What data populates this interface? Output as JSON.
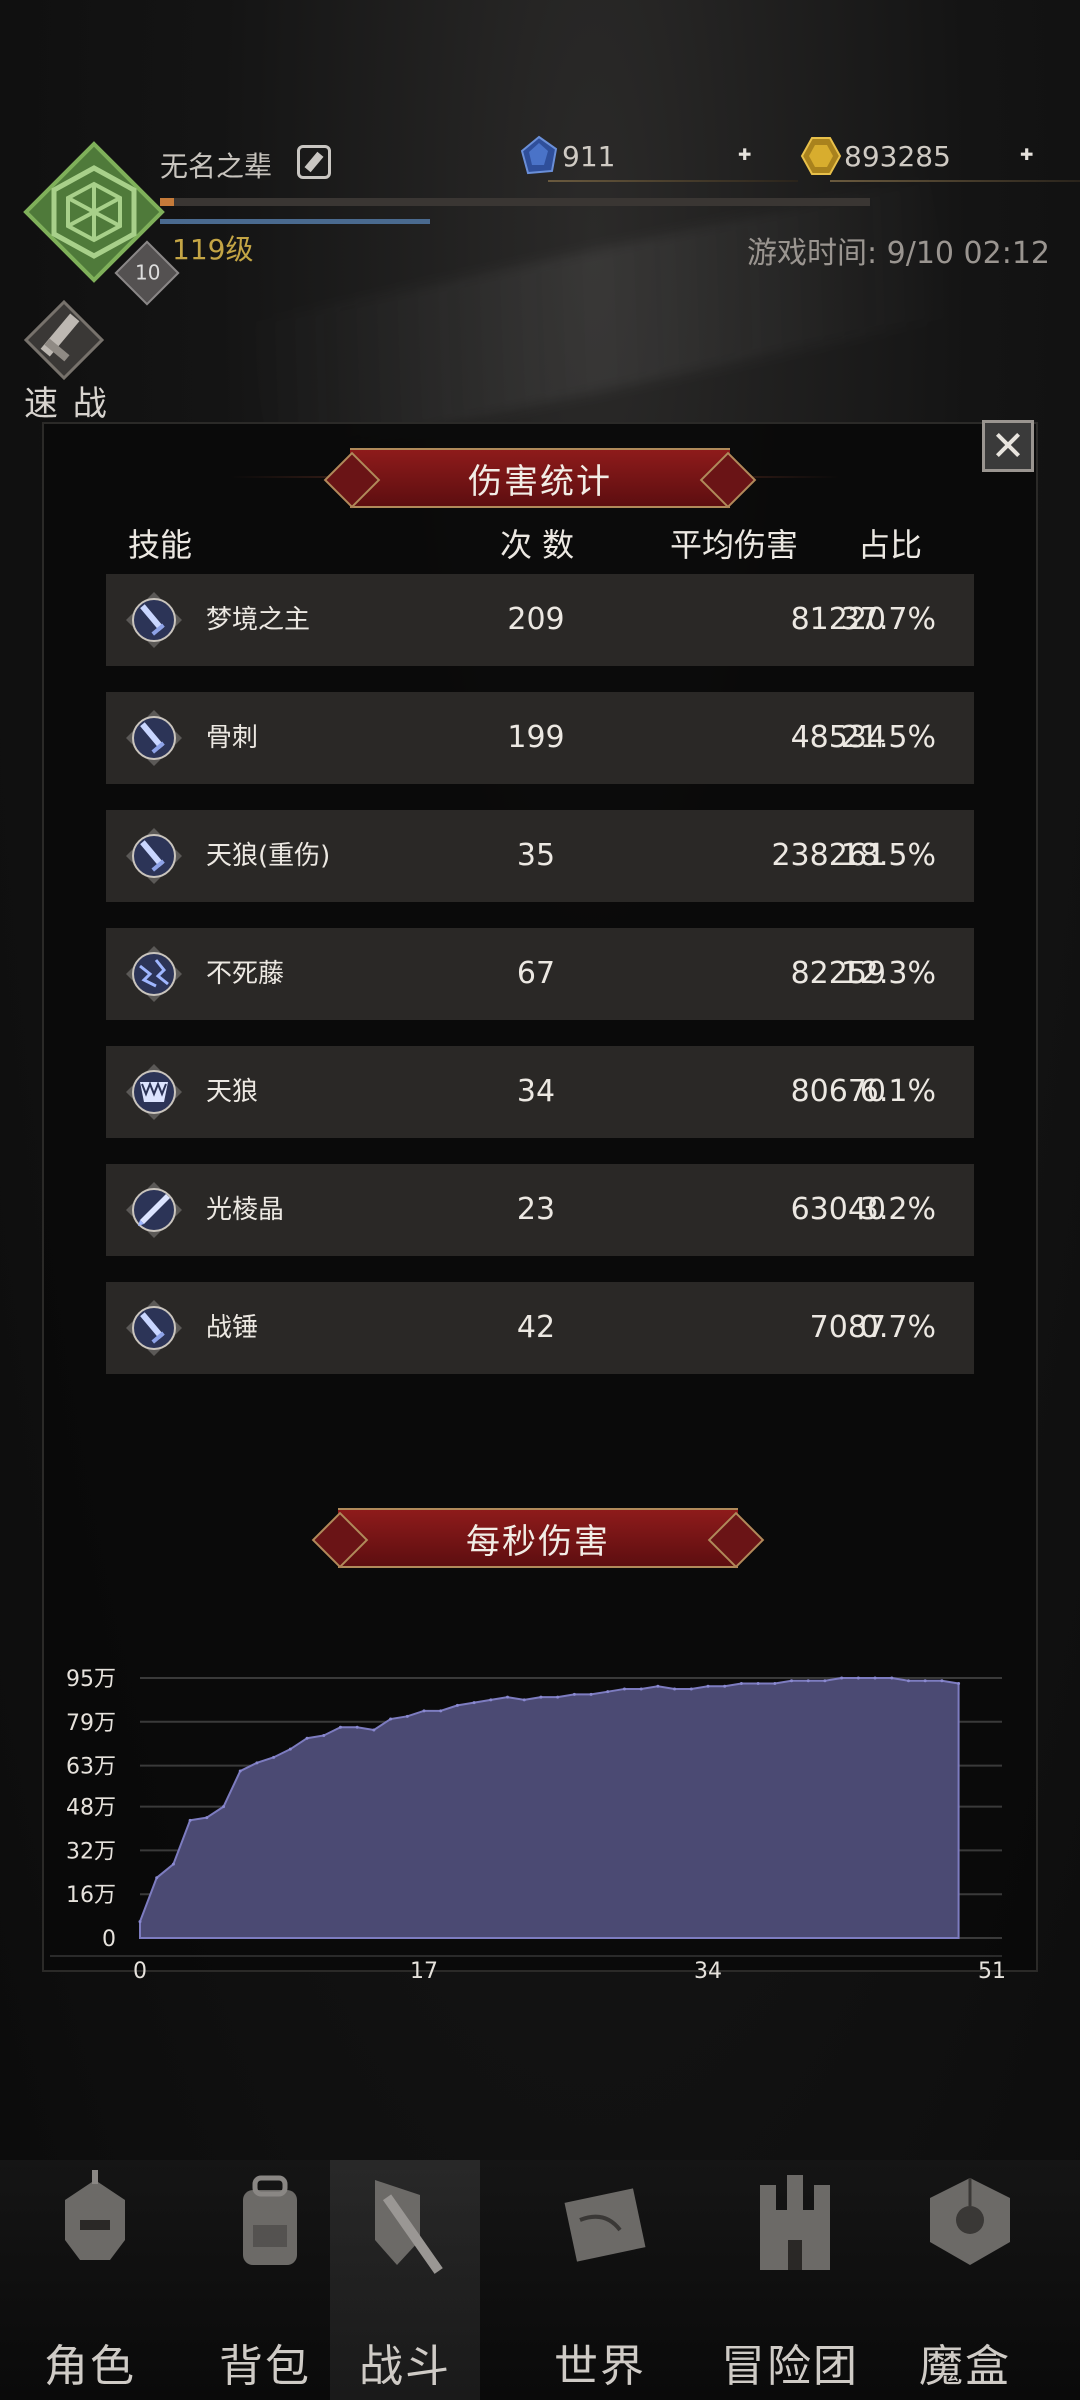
{
  "player": {
    "name": "无名之辈",
    "level_label": "119级",
    "badge_level": "10",
    "xp_fraction": 0.02,
    "mp_fraction": 0.38
  },
  "currency": {
    "gems": "911",
    "gold": "893285",
    "add_symbol": "✚"
  },
  "game_time": "游戏时间: 9/10 02:12",
  "quick_battle_label": "速 战",
  "damage_stats": {
    "title": "伤害统计",
    "headers": {
      "skill": "技能",
      "count": "次 数",
      "avg": "平均伤害",
      "ratio": "占比"
    },
    "rows": [
      {
        "icon": "sword-icon",
        "name": "梦境之主",
        "count": "209",
        "avg": "81220",
        "ratio": "37.7%"
      },
      {
        "icon": "sword-icon",
        "name": "骨刺",
        "count": "199",
        "avg": "48534",
        "ratio": "21.5%"
      },
      {
        "icon": "sword-icon",
        "name": "天狼(重伤)",
        "count": "35",
        "avg": "238261",
        "ratio": "18.5%"
      },
      {
        "icon": "lightning-vine-icon",
        "name": "不死藤",
        "count": "67",
        "avg": "82259",
        "ratio": "12.3%"
      },
      {
        "icon": "fang-icon",
        "name": "天狼",
        "count": "34",
        "avg": "80670",
        "ratio": "6.1%"
      },
      {
        "icon": "crystal-blade-icon",
        "name": "光棱晶",
        "count": "23",
        "avg": "63040",
        "ratio": "3.2%"
      },
      {
        "icon": "sword-icon",
        "name": "战锤",
        "count": "42",
        "avg": "7087",
        "ratio": "0.7%"
      }
    ]
  },
  "dps_title": "每秒伤害",
  "chart_data": {
    "type": "area",
    "title": "每秒伤害",
    "x_ticks": [
      "0",
      "17",
      "34",
      "51"
    ],
    "y_ticks": [
      "0",
      "16万",
      "32万",
      "48万",
      "63万",
      "79万",
      "95万"
    ],
    "xlim": [
      0,
      51
    ],
    "ylim": [
      0,
      95
    ],
    "y_unit": "万",
    "grid": true,
    "series": [
      {
        "color": "#4b4a73",
        "x": [
          0,
          1,
          2,
          3,
          4,
          5,
          6,
          7,
          8,
          9,
          10,
          11,
          12,
          13,
          14,
          15,
          16,
          17,
          18,
          19,
          20,
          21,
          22,
          23,
          24,
          25,
          26,
          27,
          28,
          29,
          30,
          31,
          32,
          33,
          34,
          35,
          36,
          37,
          38,
          39,
          40,
          41,
          42,
          43,
          44,
          45,
          46,
          47,
          48,
          49
        ],
        "values": [
          6,
          22,
          27,
          43,
          44,
          48,
          61,
          64,
          66,
          69,
          73,
          74,
          77,
          77,
          76,
          80,
          81,
          83,
          83,
          85,
          86,
          87,
          88,
          87,
          88,
          88,
          89,
          89,
          90,
          91,
          91,
          92,
          91,
          91,
          92,
          92,
          93,
          93,
          93,
          94,
          94,
          94,
          95,
          95,
          95,
          95,
          94,
          94,
          94,
          93
        ]
      }
    ]
  },
  "nav": [
    {
      "icon": "helmet-icon",
      "label": "角色"
    },
    {
      "icon": "backpack-icon",
      "label": "背包"
    },
    {
      "icon": "shield-sword-icon",
      "label": "战斗"
    },
    {
      "icon": "map-scroll-icon",
      "label": "世界"
    },
    {
      "icon": "castle-icon",
      "label": "冒险团"
    },
    {
      "icon": "cube-icon",
      "label": "魔盒"
    }
  ]
}
